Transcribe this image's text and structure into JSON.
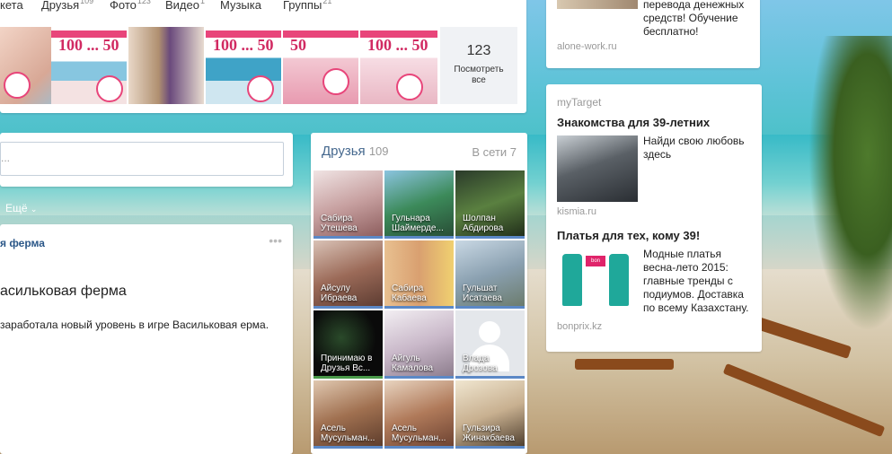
{
  "nav": [
    {
      "label": "кета",
      "count": ""
    },
    {
      "label": "Друзья",
      "count": "109"
    },
    {
      "label": "Фото",
      "count": "123"
    },
    {
      "label": "Видео",
      "count": "1"
    },
    {
      "label": "Музыка",
      "count": ""
    },
    {
      "label": "Группы",
      "count": "21"
    }
  ],
  "photos": {
    "see_all_count": "123",
    "see_all_label": "Посмотреть все"
  },
  "composer": {
    "placeholder": "...",
    "more_label": "Ещё"
  },
  "feed": {
    "title": "я ферма",
    "app_name": "асильковая ферма",
    "text": "заработала новый уровень в игре Васильковая ерма."
  },
  "friends": {
    "title": "Друзья",
    "count": "109",
    "online_label": "В сети 7",
    "list": [
      {
        "name": "Сабира Утешева"
      },
      {
        "name": "Гульнара Шаймерде..."
      },
      {
        "name": "Шолпан Абдирова"
      },
      {
        "name": "Айсулу Ибраева"
      },
      {
        "name": "Сабира Кабаева"
      },
      {
        "name": "Гульшат Исатаева"
      },
      {
        "name": "Принимаю в Друзья Вс..."
      },
      {
        "name": "Айгуль Камалова"
      },
      {
        "name": "Влада Дрозова"
      },
      {
        "name": "Асель Мусульман..."
      },
      {
        "name": "Асель Мусульман..."
      },
      {
        "name": "Гульзира Жинакбаева"
      }
    ]
  },
  "ad_top": {
    "text": "перевода денежных средств! Обучение бесплатно!",
    "source": "alone-work.ru"
  },
  "mytarget": {
    "label": "myTarget",
    "ads": [
      {
        "title": "Знакомства для 39-летних",
        "text": "Найди свою любовь здесь",
        "source": "kismia.ru"
      },
      {
        "title": "Платья для тех, кому 39!",
        "text": "Модные платья весна-лето 2015: главные тренды с подиумов. Доставка по всему Казахстану.",
        "source": "bonprix.kz"
      }
    ]
  },
  "colors": {
    "link": "#2b5788",
    "accent": "#e8457a",
    "online_bar": "#5b88c6"
  }
}
